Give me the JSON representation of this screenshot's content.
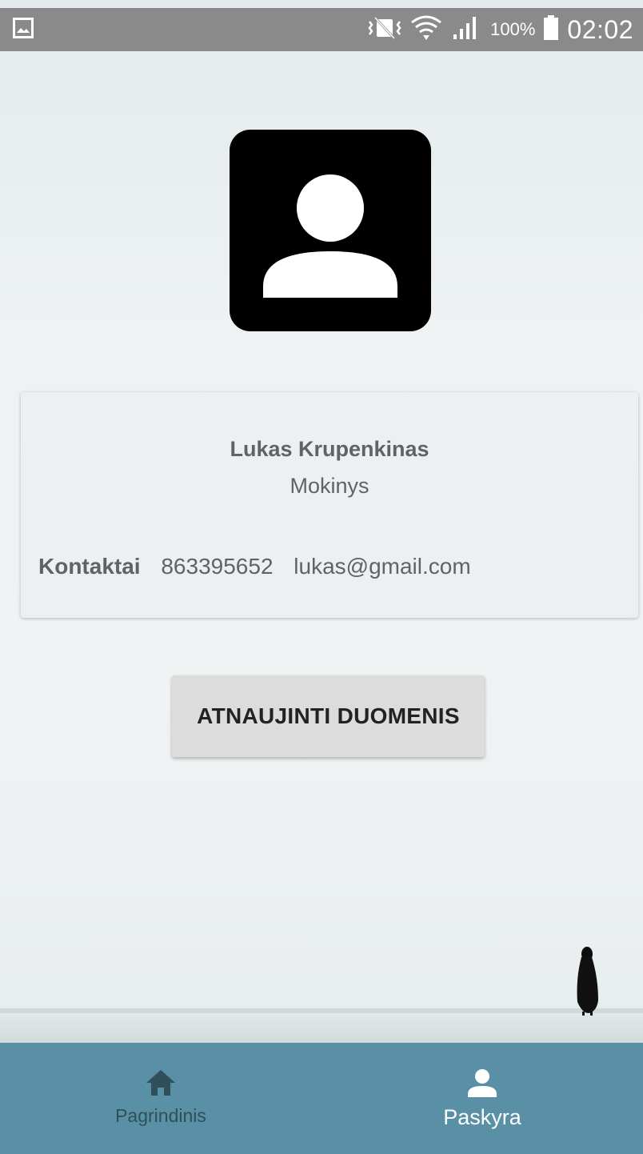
{
  "status_bar": {
    "battery_percent": "100%",
    "time": "02:02",
    "icons": [
      "gallery-notification-icon",
      "vibrate-icon",
      "wifi-icon",
      "signal-icon",
      "battery-icon"
    ]
  },
  "profile": {
    "avatar_icon": "person-icon",
    "name": "Lukas Krupenkinas",
    "role": "Mokinys",
    "contacts_label": "Kontaktai",
    "phone": "863395652",
    "email": "lukas@gmail.com"
  },
  "actions": {
    "update_label": "ATNAUJINTI DUOMENIS"
  },
  "bottom_nav": {
    "items": [
      {
        "label": "Pagrindinis",
        "icon": "home-icon",
        "active": false
      },
      {
        "label": "Paskyra",
        "icon": "person-icon",
        "active": true
      }
    ]
  },
  "colors": {
    "nav_background": "#5990a5",
    "nav_active": "#ffffff",
    "nav_inactive": "#2f4f5a",
    "card_background": "#edf0f3",
    "button_background": "#dcdcdc"
  }
}
